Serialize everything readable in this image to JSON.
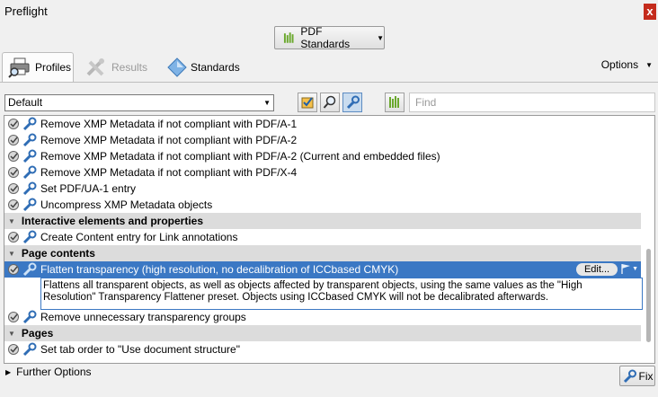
{
  "window": {
    "title": "Preflight",
    "close_glyph": "x"
  },
  "standards_button": {
    "label": "PDF Standards",
    "icon": "bars-icon"
  },
  "tabs": [
    {
      "label": "Profiles",
      "icon": "printer-magnifier-icon",
      "active": true
    },
    {
      "label": "Results",
      "icon": "tools-icon",
      "disabled": true
    },
    {
      "label": "Standards",
      "icon": "diamond-icon"
    }
  ],
  "options_label": "Options",
  "toolbar": {
    "profile_select": "Default",
    "find_placeholder": "Find"
  },
  "list": {
    "rows": [
      {
        "kind": "fixup",
        "text": "Remove XMP Metadata if not compliant with PDF/A-1"
      },
      {
        "kind": "fixup",
        "text": "Remove XMP Metadata if not compliant with PDF/A-2"
      },
      {
        "kind": "fixup",
        "text": "Remove XMP Metadata if not compliant with PDF/A-2 (Current and embedded files)"
      },
      {
        "kind": "fixup",
        "text": "Remove XMP Metadata if not compliant with PDF/X-4"
      },
      {
        "kind": "fixup",
        "text": "Set PDF/UA-1 entry"
      },
      {
        "kind": "fixup",
        "text": "Uncompress XMP Metadata objects"
      },
      {
        "kind": "section",
        "text": "Interactive elements and properties"
      },
      {
        "kind": "fixup",
        "text": "Create Content entry for Link annotations"
      },
      {
        "kind": "section",
        "text": "Page contents"
      },
      {
        "kind": "fixup",
        "text": "Flatten transparency (high resolution, no decalibration of ICCbased CMYK)",
        "selected": true
      },
      {
        "kind": "fixup",
        "text": "Remove unnecessary transparency groups"
      },
      {
        "kind": "section",
        "text": "Pages"
      },
      {
        "kind": "fixup",
        "text": "Set tab order to \"Use document structure\""
      }
    ],
    "selected_edit_label": "Edit...",
    "selected_description_line1": "Flattens all transparent objects, as well as objects affected by transparent objects, using the same values as the \"High",
    "selected_description_line2": "Resolution\" Transparency Flattener preset. Objects using ICCbased CMYK will not be decalibrated afterwards."
  },
  "footer": {
    "further_options": "Further Options",
    "fix_label": "Fix"
  },
  "colors": {
    "selection": "#3b78c4",
    "section_bg": "#dcdcdc",
    "close_red": "#c42b1c"
  }
}
